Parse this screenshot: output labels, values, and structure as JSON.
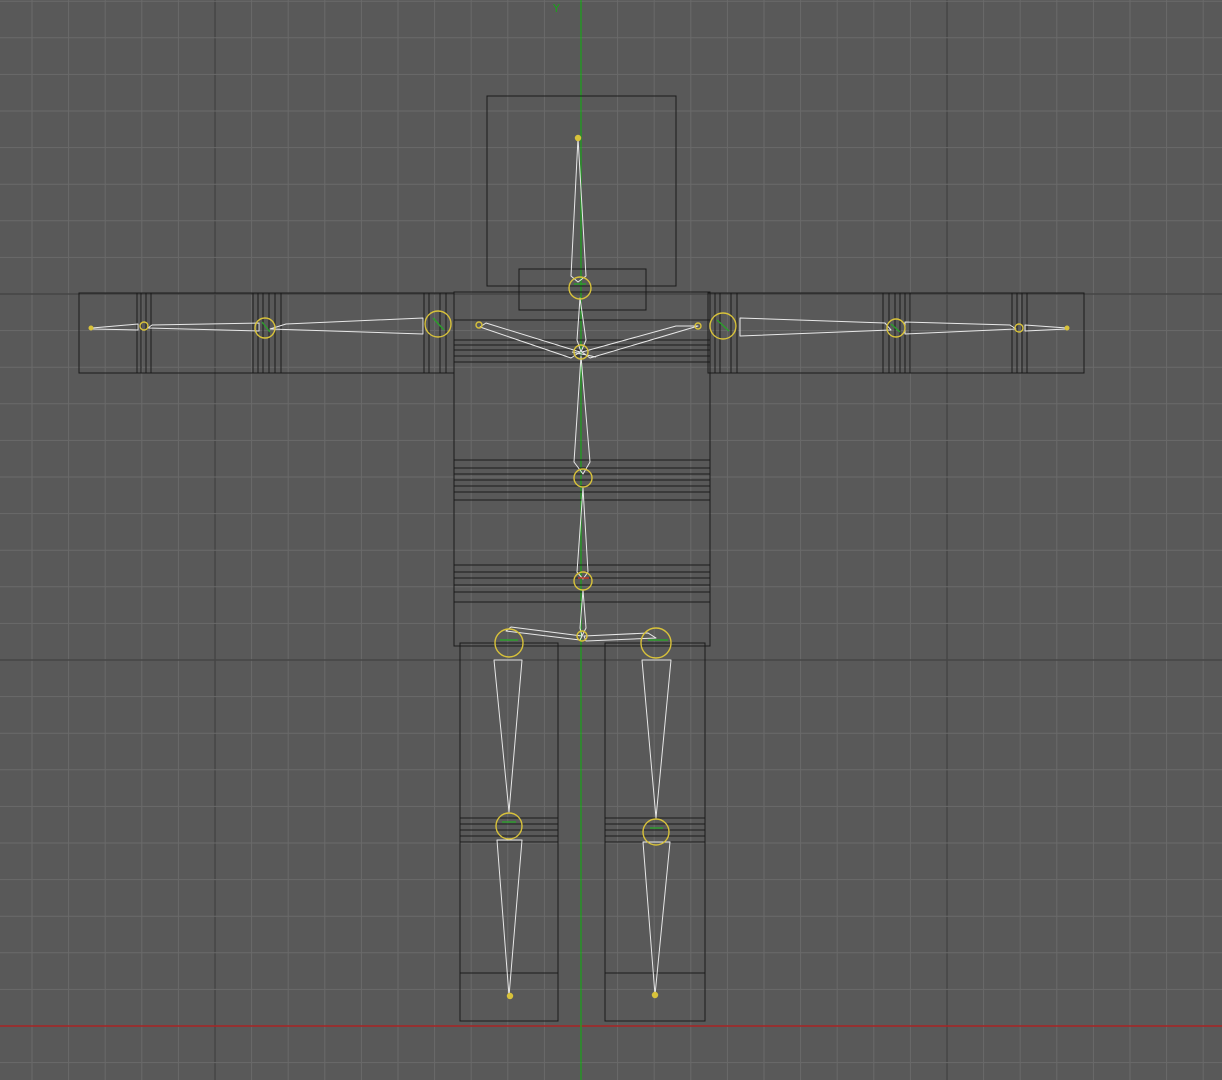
{
  "viewport": {
    "view": "front",
    "background_color": "#595959",
    "grid_minor_color": "#6a6a6a",
    "grid_major_color": "#454545",
    "y_axis_label": "Y",
    "y_axis_color": "#1faa1f",
    "x_axis_color": "#c02020"
  },
  "rig": {
    "mesh_wire_color": "#1a1a1a",
    "bone_color": "#e8e8e8",
    "joint_color": "#d8c23a",
    "joint_highlight_color": "#2aa02a"
  }
}
